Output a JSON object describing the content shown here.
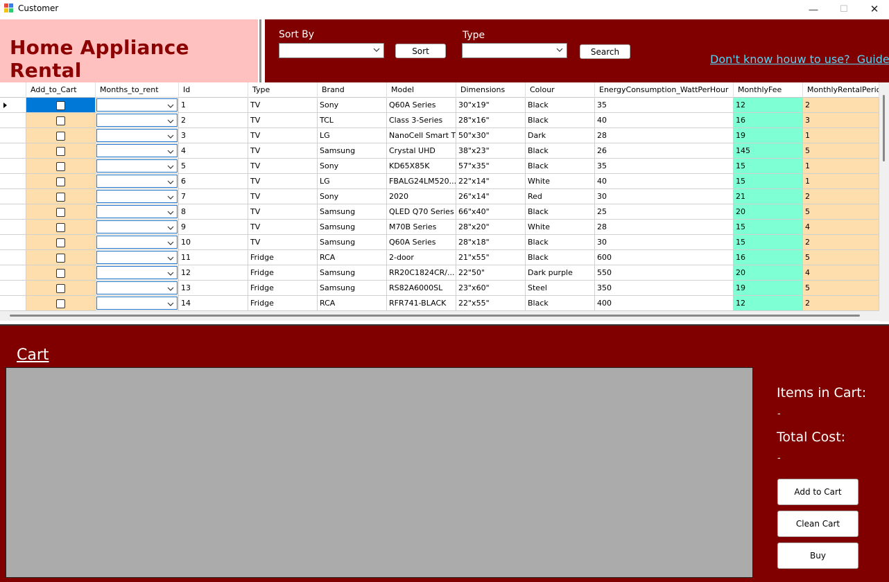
{
  "window": {
    "title": "Customer",
    "controls": {
      "minimize": "—",
      "maximize": "☐",
      "close": "✕"
    }
  },
  "header": {
    "brand_title": "Home Appliance Rental",
    "sort_by_label": "Sort By",
    "sort_by_value": "",
    "sort_button": "Sort",
    "type_label": "Type",
    "type_value": "",
    "search_button": "Search",
    "guide_link": "Don't know houw to use?  Guide"
  },
  "colors": {
    "maroon": "#800000",
    "brand_bg": "#ffc0c0",
    "peach": "#ffdead",
    "aqua": "#7fffd4",
    "cart_area": "#ababab",
    "link": "#56d3f5"
  },
  "grid": {
    "columns": [
      "Add_to_Cart",
      "Months_to_rent",
      "Id",
      "Type",
      "Brand",
      "Model",
      "Dimensions",
      "Colour",
      "EnergyConsumption_WattPerHour",
      "MonthlyFee",
      "MonthlyRentalPeriod"
    ],
    "rows": [
      [
        "1",
        "TV",
        "Sony",
        "Q60A Series",
        "30\"x19\"",
        "Black",
        "35",
        "12",
        "2"
      ],
      [
        "2",
        "TV",
        "TCL",
        "Class 3-Series",
        "28\"x16\"",
        "Black",
        "40",
        "16",
        "3"
      ],
      [
        "3",
        "TV",
        "LG",
        "NanoCell Smart TV",
        "50\"x30\"",
        "Dark",
        "28",
        "19",
        "1"
      ],
      [
        "4",
        "TV",
        "Samsung",
        "Crystal UHD",
        "38\"x23\"",
        "Black",
        "26",
        "145",
        "5"
      ],
      [
        "5",
        "TV",
        "Sony",
        "KD65X85K",
        "57\"x35\"",
        "Black",
        "35",
        "15",
        "1"
      ],
      [
        "6",
        "TV",
        "LG",
        "FBALG24LM520...",
        "22\"x14\"",
        "White",
        "40",
        "15",
        "1"
      ],
      [
        "7",
        "TV",
        "Sony",
        "2020",
        "26\"x14\"",
        "Red",
        "30",
        "21",
        "2"
      ],
      [
        "8",
        "TV",
        "Samsung",
        "QLED Q70 Series",
        "66\"x40\"",
        "Black",
        "25",
        "20",
        "5"
      ],
      [
        "9",
        "TV",
        "Samsung",
        "M70B Series",
        "28\"x20\"",
        "White",
        "28",
        "15",
        "4"
      ],
      [
        "10",
        "TV",
        "Samsung",
        "Q60A Series",
        "28\"x18\"",
        "Black",
        "30",
        "15",
        "2"
      ],
      [
        "11",
        "Fridge",
        "RCA",
        "2-door",
        "21\"x55\"",
        "Black",
        "600",
        "16",
        "5"
      ],
      [
        "12",
        "Fridge",
        "Samsung",
        "RR20C1824CR/...",
        "22\"50\"",
        "Dark purple",
        "550",
        "20",
        "4"
      ],
      [
        "13",
        "Fridge",
        "Samsung",
        "RS82A6000SL",
        "23\"x60\"",
        "Steel",
        "350",
        "19",
        "5"
      ],
      [
        "14",
        "Fridge",
        "RCA",
        "RFR741-BLACK",
        "22\"x55\"",
        "Black",
        "400",
        "12",
        "2"
      ]
    ]
  },
  "cart": {
    "title": "Cart",
    "items_label": "Items in Cart:",
    "items_value": "-",
    "total_label": "Total Cost:",
    "total_value": "-",
    "add_button": "Add to Cart",
    "clean_button": "Clean Cart",
    "buy_button": "Buy"
  }
}
